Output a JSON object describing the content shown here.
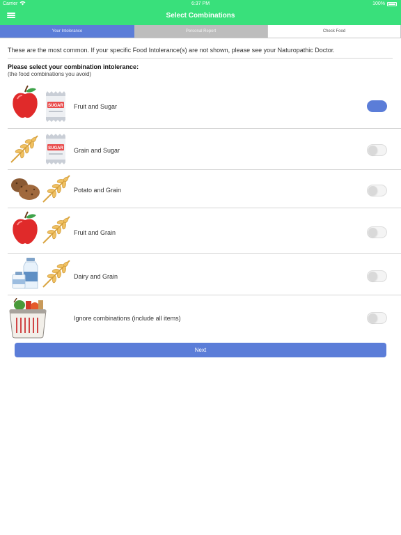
{
  "status_bar": {
    "carrier": "Carrier",
    "time": "6:37 PM",
    "battery": "100%"
  },
  "nav": {
    "title": "Select Combinations"
  },
  "tabs": [
    {
      "label": "Your Intolerance",
      "state": "active"
    },
    {
      "label": "Personal Report",
      "state": "disabled"
    },
    {
      "label": "Check Food",
      "state": "inactive"
    }
  ],
  "intro_text": "These are the most common. If your specific Food Intolerance(s) are not shown, please see your Naturopathic Doctor.",
  "prompt": "Please select your combination intolerance:",
  "hint": "(the food combinations you avoid)",
  "combinations": [
    {
      "label": "Fruit and Sugar",
      "icons": [
        "apple-icon",
        "sugar-bag-icon"
      ],
      "icon_text": "SUGAR",
      "enabled": true
    },
    {
      "label": "Grain and Sugar",
      "icons": [
        "wheat-icon",
        "sugar-bag-icon"
      ],
      "icon_text": "SUGAR",
      "enabled": false
    },
    {
      "label": "Potato and Grain",
      "icons": [
        "potato-icon",
        "wheat-icon"
      ],
      "enabled": false
    },
    {
      "label": "Fruit and Grain",
      "icons": [
        "apple-icon",
        "wheat-icon"
      ],
      "enabled": false
    },
    {
      "label": "Dairy and Grain",
      "icons": [
        "milk-bottles-icon",
        "wheat-icon"
      ],
      "enabled": false
    },
    {
      "label": "Ignore combinations (include all items)",
      "icons": [
        "grocery-basket-icon"
      ],
      "enabled": false
    }
  ],
  "next_button": "Next",
  "colors": {
    "header": "#39e07b",
    "accent": "#5b7dd8",
    "tab_disabled": "#bdbdbd"
  }
}
